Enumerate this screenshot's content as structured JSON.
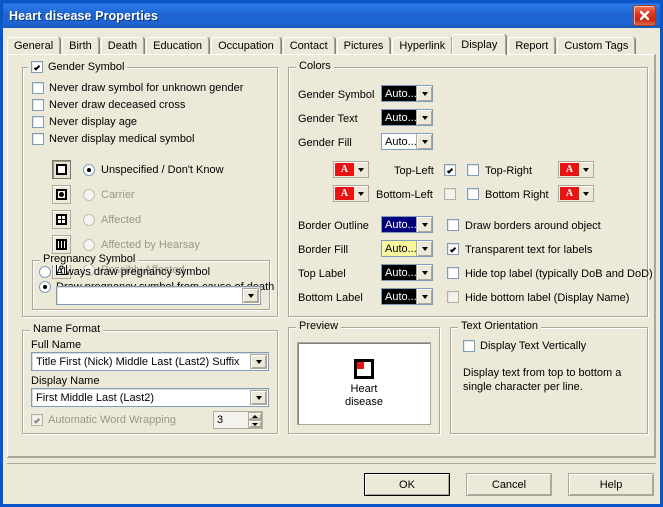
{
  "window": {
    "title": "Heart disease Properties",
    "close_icon": "close-icon"
  },
  "tabs": [
    {
      "label": "General",
      "active": false
    },
    {
      "label": "Birth",
      "active": false
    },
    {
      "label": "Death",
      "active": false
    },
    {
      "label": "Education",
      "active": false
    },
    {
      "label": "Occupation",
      "active": false
    },
    {
      "label": "Contact",
      "active": false
    },
    {
      "label": "Pictures",
      "active": false
    },
    {
      "label": "Hyperlink",
      "active": false
    },
    {
      "label": "Display",
      "active": true
    },
    {
      "label": "Report",
      "active": false
    },
    {
      "label": "Custom Tags",
      "active": false
    }
  ],
  "gender_group": {
    "legend": "Gender Symbol",
    "legend_checked": true,
    "options": [
      {
        "label": "Never draw symbol for unknown gender",
        "checked": false
      },
      {
        "label": "Never draw deceased cross",
        "checked": false
      },
      {
        "label": "Never display age",
        "checked": false
      },
      {
        "label": "Never display medical symbol",
        "checked": false
      }
    ],
    "symbols": [
      {
        "label": "Unspecified / Don't Know",
        "icon": "square-empty-icon",
        "selected": true
      },
      {
        "label": "Carrier",
        "icon": "square-dot-icon",
        "selected": false
      },
      {
        "label": "Affected",
        "icon": "square-quadrant-icon",
        "selected": false
      },
      {
        "label": "Affected by Hearsay",
        "icon": "square-bars-icon",
        "selected": false
      },
      {
        "label": "Possibly Affected",
        "icon": "square-question-icon",
        "selected": false
      }
    ]
  },
  "pregnancy_group": {
    "legend": "Pregnancy Symbol",
    "options": [
      {
        "label": "Always draw pregnancy symbol",
        "checked": false
      },
      {
        "label": "Draw pregnancy symbol from cause of death",
        "checked": true
      }
    ],
    "cause_value": "",
    "cause_icon": "chevron-down-icon"
  },
  "name_format": {
    "legend": "Name Format",
    "full_name_label": "Full Name",
    "full_name_value": "Title First (Nick) Middle Last (Last2) Suffix",
    "display_name_label": "Display Name",
    "display_name_value": "First Middle Last (Last2)",
    "word_wrap_label": "Automatic Word Wrapping",
    "word_wrap_checked": true,
    "word_wrap_disabled": true,
    "word_wrap_value": "3"
  },
  "colors_group": {
    "legend": "Colors",
    "rows": [
      {
        "label": "Gender Symbol",
        "value": "Auto...",
        "bg": "#000000",
        "fg": "#ffffff"
      },
      {
        "label": "Gender Text",
        "value": "Auto...",
        "bg": "#000000",
        "fg": "#ffffff"
      },
      {
        "label": "Gender Fill",
        "value": "Auto...",
        "bg": "#ffffff",
        "fg": "#000000"
      }
    ],
    "corners": {
      "top_left_label": "Top-Left",
      "top_left_checked": true,
      "top_right_label": "Top-Right",
      "top_right_checked": false,
      "bottom_left_label": "Bottom-Left",
      "bottom_left_checked": false,
      "bottom_right_label": "Bottom Right",
      "bottom_right_checked": false,
      "swatch_letter": "A",
      "swatch_bg": "#e81414",
      "swatch_fg": "#ffffff"
    },
    "border_rows": [
      {
        "label": "Border Outline",
        "value": "Auto...",
        "bg": "#00007a",
        "fg": "#ffffff",
        "check_label": "Draw borders around object",
        "checked": false
      },
      {
        "label": "Border Fill",
        "value": "Auto...",
        "bg": "#fbf79e",
        "fg": "#000000",
        "check_label": "Transparent text for labels",
        "checked": true
      },
      {
        "label": "Top Label",
        "value": "Auto...",
        "bg": "#000000",
        "fg": "#ffffff",
        "check_label": "Hide top label (typically DoB and DoD)",
        "checked": false
      },
      {
        "label": "Bottom Label",
        "value": "Auto...",
        "bg": "#000000",
        "fg": "#ffffff",
        "check_label": "Hide bottom label (Display Name)",
        "checked": false
      }
    ]
  },
  "preview": {
    "legend": "Preview",
    "line1": "Heart",
    "line2": "disease",
    "icon": "heart-disease-symbol-icon",
    "icon_fill": "#e81414"
  },
  "text_orientation": {
    "legend": "Text Orientation",
    "check_label": "Display Text Vertically",
    "checked": false,
    "description": "Display text from top to bottom a single character per line."
  },
  "buttons": {
    "ok": "OK",
    "cancel": "Cancel",
    "help": "Help"
  }
}
